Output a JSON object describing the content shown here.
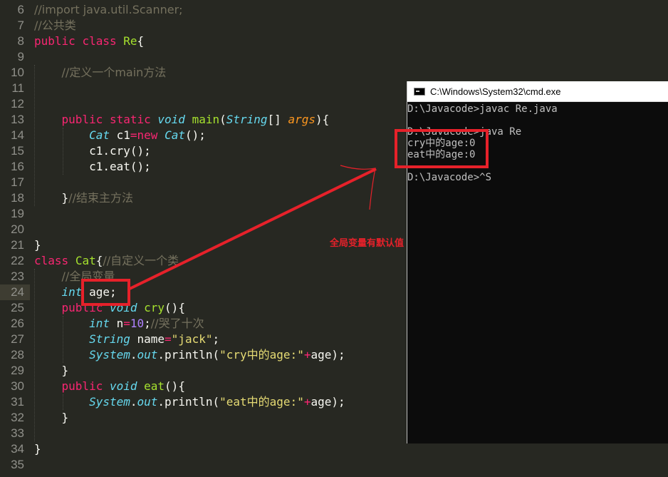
{
  "editor": {
    "line_numbers": [
      "6",
      "7",
      "8",
      "9",
      "10",
      "11",
      "12",
      "13",
      "14",
      "15",
      "16",
      "17",
      "18",
      "19",
      "20",
      "21",
      "22",
      "23",
      "24",
      "25",
      "26",
      "27",
      "28",
      "29",
      "30",
      "31",
      "32",
      "33",
      "34",
      "35"
    ],
    "lines": [
      [
        {
          "t": "//import java.util.Scanner;",
          "c": "cm"
        }
      ],
      [
        {
          "t": "//公共类",
          "c": "cm"
        }
      ],
      [
        {
          "t": "public",
          "c": "kw"
        },
        {
          "t": " ",
          "c": "plain"
        },
        {
          "t": "class",
          "c": "kw"
        },
        {
          "t": " ",
          "c": "plain"
        },
        {
          "t": "Re",
          "c": "fn"
        },
        {
          "t": "{",
          "c": "plain"
        }
      ],
      [],
      [
        {
          "t": "    ",
          "c": "plain"
        },
        {
          "t": "//定义一个main方法",
          "c": "cm"
        }
      ],
      [],
      [],
      [
        {
          "t": "    ",
          "c": "plain"
        },
        {
          "t": "public",
          "c": "kw"
        },
        {
          "t": " ",
          "c": "plain"
        },
        {
          "t": "static",
          "c": "kw"
        },
        {
          "t": " ",
          "c": "plain"
        },
        {
          "t": "void",
          "c": "type"
        },
        {
          "t": " ",
          "c": "plain"
        },
        {
          "t": "main",
          "c": "fn"
        },
        {
          "t": "(",
          "c": "plain"
        },
        {
          "t": "String",
          "c": "type"
        },
        {
          "t": "[] ",
          "c": "plain"
        },
        {
          "t": "args",
          "c": "param"
        },
        {
          "t": "){",
          "c": "plain"
        }
      ],
      [
        {
          "t": "        ",
          "c": "plain"
        },
        {
          "t": "Cat",
          "c": "type"
        },
        {
          "t": " c1",
          "c": "plain"
        },
        {
          "t": "=",
          "c": "kw"
        },
        {
          "t": "new",
          "c": "kw"
        },
        {
          "t": " ",
          "c": "plain"
        },
        {
          "t": "Cat",
          "c": "type"
        },
        {
          "t": "();",
          "c": "plain"
        }
      ],
      [
        {
          "t": "        c1.",
          "c": "plain"
        },
        {
          "t": "cry",
          "c": "plain"
        },
        {
          "t": "();",
          "c": "plain"
        }
      ],
      [
        {
          "t": "        c1.",
          "c": "plain"
        },
        {
          "t": "eat",
          "c": "plain"
        },
        {
          "t": "();",
          "c": "plain"
        }
      ],
      [],
      [
        {
          "t": "    }",
          "c": "plain"
        },
        {
          "t": "//结束主方法",
          "c": "cm"
        }
      ],
      [],
      [],
      [
        {
          "t": "}",
          "c": "plain"
        }
      ],
      [
        {
          "t": "class",
          "c": "kw"
        },
        {
          "t": " ",
          "c": "plain"
        },
        {
          "t": "Cat",
          "c": "fn"
        },
        {
          "t": "{",
          "c": "plain"
        },
        {
          "t": "//自定义一个类",
          "c": "cm"
        }
      ],
      [
        {
          "t": "    ",
          "c": "plain"
        },
        {
          "t": "//全局变量",
          "c": "cm"
        }
      ],
      [
        {
          "t": "    ",
          "c": "plain"
        },
        {
          "t": "int",
          "c": "type"
        },
        {
          "t": " age;",
          "c": "plain"
        }
      ],
      [
        {
          "t": "    ",
          "c": "plain"
        },
        {
          "t": "public",
          "c": "kw"
        },
        {
          "t": " ",
          "c": "plain"
        },
        {
          "t": "void",
          "c": "type"
        },
        {
          "t": " ",
          "c": "plain"
        },
        {
          "t": "cry",
          "c": "fn"
        },
        {
          "t": "(){",
          "c": "plain"
        }
      ],
      [
        {
          "t": "        ",
          "c": "plain"
        },
        {
          "t": "int",
          "c": "type"
        },
        {
          "t": " n",
          "c": "plain"
        },
        {
          "t": "=",
          "c": "kw"
        },
        {
          "t": "10",
          "c": "num"
        },
        {
          "t": ";",
          "c": "plain"
        },
        {
          "t": "//哭了十次",
          "c": "cm"
        }
      ],
      [
        {
          "t": "        ",
          "c": "plain"
        },
        {
          "t": "String",
          "c": "type"
        },
        {
          "t": " name",
          "c": "plain"
        },
        {
          "t": "=",
          "c": "kw"
        },
        {
          "t": "\"jack\"",
          "c": "str"
        },
        {
          "t": ";",
          "c": "plain"
        }
      ],
      [
        {
          "t": "        ",
          "c": "plain"
        },
        {
          "t": "System",
          "c": "type"
        },
        {
          "t": ".",
          "c": "plain"
        },
        {
          "t": "out",
          "c": "type"
        },
        {
          "t": ".",
          "c": "plain"
        },
        {
          "t": "println",
          "c": "plain"
        },
        {
          "t": "(",
          "c": "plain"
        },
        {
          "t": "\"cry中的age:\"",
          "c": "str"
        },
        {
          "t": "+",
          "c": "kw"
        },
        {
          "t": "age);",
          "c": "plain"
        }
      ],
      [
        {
          "t": "    }",
          "c": "plain"
        }
      ],
      [
        {
          "t": "    ",
          "c": "plain"
        },
        {
          "t": "public",
          "c": "kw"
        },
        {
          "t": " ",
          "c": "plain"
        },
        {
          "t": "void",
          "c": "type"
        },
        {
          "t": " ",
          "c": "plain"
        },
        {
          "t": "eat",
          "c": "fn"
        },
        {
          "t": "(){",
          "c": "plain"
        }
      ],
      [
        {
          "t": "        ",
          "c": "plain"
        },
        {
          "t": "System",
          "c": "type"
        },
        {
          "t": ".",
          "c": "plain"
        },
        {
          "t": "out",
          "c": "type"
        },
        {
          "t": ".",
          "c": "plain"
        },
        {
          "t": "println",
          "c": "plain"
        },
        {
          "t": "(",
          "c": "plain"
        },
        {
          "t": "\"eat中的age:\"",
          "c": "str"
        },
        {
          "t": "+",
          "c": "kw"
        },
        {
          "t": "age);",
          "c": "plain"
        }
      ],
      [
        {
          "t": "    }",
          "c": "plain"
        }
      ],
      [],
      [
        {
          "t": "}",
          "c": "plain"
        }
      ],
      []
    ],
    "current_line": "24"
  },
  "cmd": {
    "title": "C:\\Windows\\System32\\cmd.exe",
    "icon": "console-icon",
    "lines": [
      "D:\\Javacode>javac Re.java",
      "",
      "D:\\Javacode>java Re",
      "cry中的age:0",
      "eat中的age:0",
      "",
      "D:\\Javacode>^S"
    ]
  },
  "annotation": {
    "label": "全局变量有默认值",
    "color": "#e6212a"
  },
  "colors": {
    "editor_bg": "#272822",
    "keyword": "#f92672",
    "type": "#66d9ef",
    "function": "#a6e22e",
    "string": "#e6db74",
    "number": "#ae81ff",
    "comment": "#75715e",
    "cmd_bg": "#0c0c0c",
    "cmd_text": "#c0c0c0"
  }
}
